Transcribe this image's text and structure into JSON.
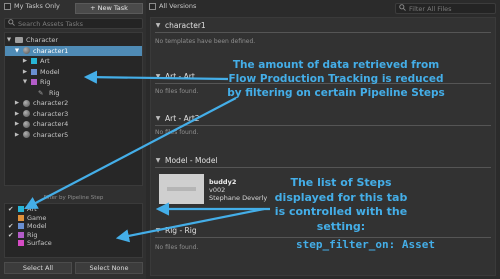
{
  "left_panel": {
    "my_tasks_label": "My Tasks Only",
    "new_task_label": "+ New Task",
    "search_placeholder": "Search Assets Tasks",
    "tree": [
      {
        "label": "Character",
        "type": "folder",
        "expanded": true
      },
      {
        "label": "character1",
        "type": "entity",
        "expanded": true,
        "selected": true
      },
      {
        "label": "Art",
        "type": "step",
        "color": "#27b5d6"
      },
      {
        "label": "Model",
        "type": "step",
        "color": "#6a8fd1"
      },
      {
        "label": "Rig",
        "type": "step",
        "color": "#b35cc8",
        "expanded": true
      },
      {
        "label": "Rig",
        "type": "task"
      },
      {
        "label": "character2",
        "type": "entity"
      },
      {
        "label": "character3",
        "type": "entity"
      },
      {
        "label": "character4",
        "type": "entity"
      },
      {
        "label": "character5",
        "type": "entity"
      }
    ],
    "filter_title": "Filter by Pipeline Step",
    "filter_steps": [
      {
        "label": "Art",
        "checked": true,
        "color": "#27b5d6"
      },
      {
        "label": "Game",
        "checked": false,
        "color": "#e0913a"
      },
      {
        "label": "Model",
        "checked": true,
        "color": "#6a8fd1"
      },
      {
        "label": "Rig",
        "checked": true,
        "color": "#b35cc8"
      },
      {
        "label": "Surface",
        "checked": false,
        "color": "#d64cc4"
      }
    ],
    "select_all_label": "Select All",
    "select_none_label": "Select None"
  },
  "right_panel": {
    "all_versions_label": "All Versions",
    "filter_placeholder": "Filter All Files",
    "sections": [
      {
        "title": "character1",
        "message": "No templates have been defined."
      },
      {
        "title": "Art - Art",
        "message": "No files found."
      },
      {
        "title": "Art - Art2",
        "message": "No files found."
      },
      {
        "title": "Model - Model",
        "message": ""
      },
      {
        "title": "Rig - Rig",
        "message": "No files found."
      }
    ],
    "file_card": {
      "name": "buddy2",
      "version": "v002",
      "author": "Stephane Deverly"
    }
  },
  "annotations": {
    "note1": "The amount of data retrieved from Flow Production Tracking is reduced by filtering on certain Pipeline Steps",
    "note2": "The list of Steps displayed for this tab is controlled with the setting:",
    "setting": "step_filter_on: Asset"
  },
  "colors": {
    "annotation_blue": "#44aee8",
    "selection_blue": "#4f8bb5"
  }
}
